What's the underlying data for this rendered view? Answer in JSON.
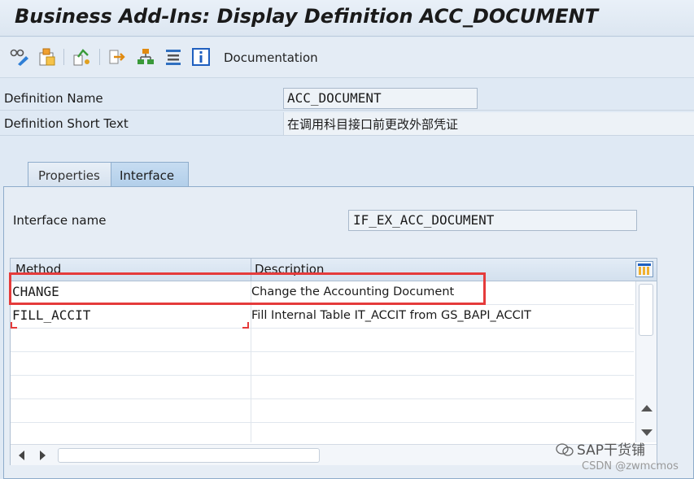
{
  "window": {
    "title": "Business Add-Ins: Display Definition ACC_DOCUMENT"
  },
  "toolbar": {
    "icons": [
      "display-change-icon",
      "other-object-icon",
      "activate-icon",
      "where-used-icon",
      "hierarchy-icon",
      "list-icon",
      "info-icon"
    ],
    "documentation_label": "Documentation"
  },
  "definition": {
    "name_label": "Definition Name",
    "name_value": "ACC_DOCUMENT",
    "short_text_label": "Definition Short Text",
    "short_text_value": "在调用科目接口前更改外部凭证"
  },
  "tabs": [
    {
      "label": "Properties",
      "active": false
    },
    {
      "label": "Interface",
      "active": true
    }
  ],
  "interface": {
    "name_label": "Interface name",
    "name_value": "IF_EX_ACC_DOCUMENT"
  },
  "methods_table": {
    "columns": [
      "Method",
      "Description"
    ],
    "rows": [
      {
        "method": "CHANGE",
        "description": "Change the Accounting Document"
      },
      {
        "method": "FILL_ACCIT",
        "description": "Fill Internal Table IT_ACCIT from GS_BAPI_ACCIT"
      }
    ]
  },
  "colors": {
    "highlight": "#e53b3b",
    "accent": "#8eaccb",
    "info": "#1f5fbf"
  },
  "watermarks": {
    "line1": "SAP干货铺",
    "line2": "CSDN @zwmcmos"
  }
}
